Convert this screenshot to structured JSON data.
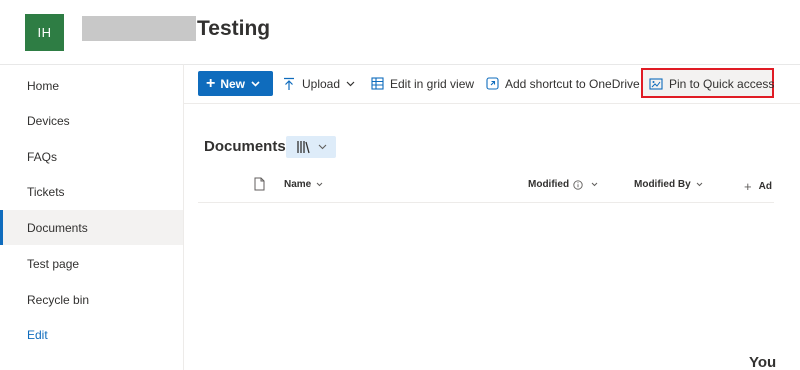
{
  "site": {
    "logo_initials": "IH",
    "title": "Testing"
  },
  "nav": {
    "items": [
      {
        "label": "Home"
      },
      {
        "label": "Devices"
      },
      {
        "label": "FAQs"
      },
      {
        "label": "Tickets"
      },
      {
        "label": "Documents",
        "active": true
      },
      {
        "label": "Test page"
      },
      {
        "label": "Recycle bin"
      }
    ],
    "edit_label": "Edit"
  },
  "commandbar": {
    "new_label": "New",
    "upload_label": "Upload",
    "grid_label": "Edit in grid view",
    "shortcut_label": "Add shortcut to OneDrive",
    "pin_label": "Pin to Quick access"
  },
  "library": {
    "title": "Documents",
    "columns": {
      "name": "Name",
      "modified": "Modified",
      "modified_by": "Modified By",
      "add": "Ad"
    }
  },
  "footer": {
    "partial_text": "You"
  },
  "colors": {
    "accent": "#0f6cbd",
    "logo": "#2e7d44",
    "highlight": "#e01b24"
  },
  "icons": [
    "plus-icon",
    "upload-icon",
    "grid-icon",
    "shortcut-icon",
    "pin-icon",
    "library-view-icon",
    "file-icon",
    "info-icon",
    "chevron-down-icon"
  ]
}
